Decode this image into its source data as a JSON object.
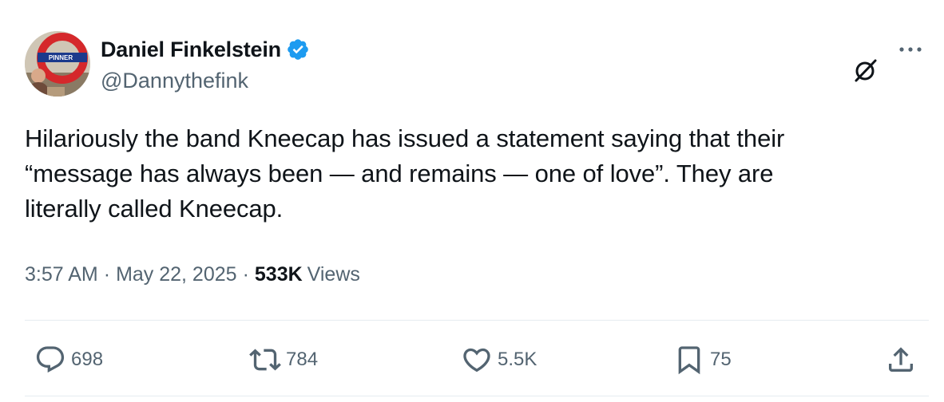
{
  "author": {
    "display_name": "Daniel Finkelstein",
    "handle": "@Dannythefink",
    "avatar_sign_text": "PINNER",
    "verified_color": "#1d9bf0"
  },
  "tweet": {
    "lines": [
      "Hilariously the band Kneecap has issued a statement saying that their",
      "“message has always been — and remains — one of love”. They are",
      "literally called Kneecap."
    ]
  },
  "meta": {
    "time": "3:57 AM",
    "separator": "·",
    "date": "May 22, 2025",
    "views_count": "533K",
    "views_label": "Views"
  },
  "actions": {
    "replies": "698",
    "reposts": "784",
    "likes": "5.5K",
    "bookmarks": "75"
  },
  "icons": {
    "grok": "grok-icon",
    "more": "more-dots-icon",
    "reply": "reply-icon",
    "repost": "repost-icon",
    "like": "heart-icon",
    "bookmark": "bookmark-icon",
    "share": "share-icon"
  },
  "colors": {
    "text_primary": "#0f1419",
    "text_secondary": "#536471",
    "divider": "#e6ecf0"
  }
}
